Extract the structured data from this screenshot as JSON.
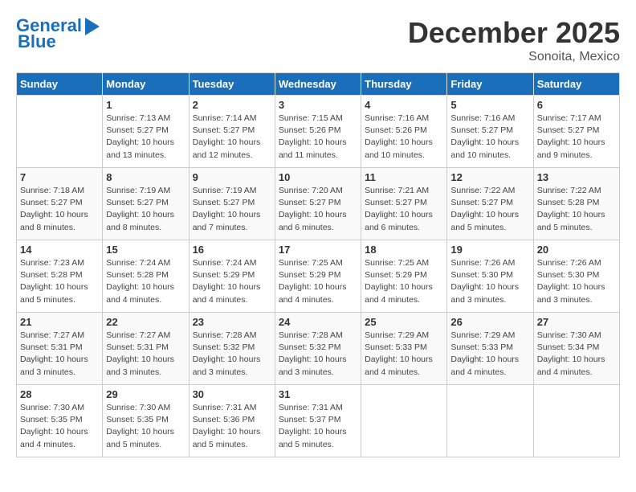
{
  "header": {
    "logo_line1": "General",
    "logo_line2": "Blue",
    "month": "December 2025",
    "location": "Sonoita, Mexico"
  },
  "days_of_week": [
    "Sunday",
    "Monday",
    "Tuesday",
    "Wednesday",
    "Thursday",
    "Friday",
    "Saturday"
  ],
  "weeks": [
    [
      {
        "day": "",
        "info": ""
      },
      {
        "day": "1",
        "info": "Sunrise: 7:13 AM\nSunset: 5:27 PM\nDaylight: 10 hours\nand 13 minutes."
      },
      {
        "day": "2",
        "info": "Sunrise: 7:14 AM\nSunset: 5:27 PM\nDaylight: 10 hours\nand 12 minutes."
      },
      {
        "day": "3",
        "info": "Sunrise: 7:15 AM\nSunset: 5:26 PM\nDaylight: 10 hours\nand 11 minutes."
      },
      {
        "day": "4",
        "info": "Sunrise: 7:16 AM\nSunset: 5:26 PM\nDaylight: 10 hours\nand 10 minutes."
      },
      {
        "day": "5",
        "info": "Sunrise: 7:16 AM\nSunset: 5:27 PM\nDaylight: 10 hours\nand 10 minutes."
      },
      {
        "day": "6",
        "info": "Sunrise: 7:17 AM\nSunset: 5:27 PM\nDaylight: 10 hours\nand 9 minutes."
      }
    ],
    [
      {
        "day": "7",
        "info": "Sunrise: 7:18 AM\nSunset: 5:27 PM\nDaylight: 10 hours\nand 8 minutes."
      },
      {
        "day": "8",
        "info": "Sunrise: 7:19 AM\nSunset: 5:27 PM\nDaylight: 10 hours\nand 8 minutes."
      },
      {
        "day": "9",
        "info": "Sunrise: 7:19 AM\nSunset: 5:27 PM\nDaylight: 10 hours\nand 7 minutes."
      },
      {
        "day": "10",
        "info": "Sunrise: 7:20 AM\nSunset: 5:27 PM\nDaylight: 10 hours\nand 6 minutes."
      },
      {
        "day": "11",
        "info": "Sunrise: 7:21 AM\nSunset: 5:27 PM\nDaylight: 10 hours\nand 6 minutes."
      },
      {
        "day": "12",
        "info": "Sunrise: 7:22 AM\nSunset: 5:27 PM\nDaylight: 10 hours\nand 5 minutes."
      },
      {
        "day": "13",
        "info": "Sunrise: 7:22 AM\nSunset: 5:28 PM\nDaylight: 10 hours\nand 5 minutes."
      }
    ],
    [
      {
        "day": "14",
        "info": "Sunrise: 7:23 AM\nSunset: 5:28 PM\nDaylight: 10 hours\nand 5 minutes."
      },
      {
        "day": "15",
        "info": "Sunrise: 7:24 AM\nSunset: 5:28 PM\nDaylight: 10 hours\nand 4 minutes."
      },
      {
        "day": "16",
        "info": "Sunrise: 7:24 AM\nSunset: 5:29 PM\nDaylight: 10 hours\nand 4 minutes."
      },
      {
        "day": "17",
        "info": "Sunrise: 7:25 AM\nSunset: 5:29 PM\nDaylight: 10 hours\nand 4 minutes."
      },
      {
        "day": "18",
        "info": "Sunrise: 7:25 AM\nSunset: 5:29 PM\nDaylight: 10 hours\nand 4 minutes."
      },
      {
        "day": "19",
        "info": "Sunrise: 7:26 AM\nSunset: 5:30 PM\nDaylight: 10 hours\nand 3 minutes."
      },
      {
        "day": "20",
        "info": "Sunrise: 7:26 AM\nSunset: 5:30 PM\nDaylight: 10 hours\nand 3 minutes."
      }
    ],
    [
      {
        "day": "21",
        "info": "Sunrise: 7:27 AM\nSunset: 5:31 PM\nDaylight: 10 hours\nand 3 minutes."
      },
      {
        "day": "22",
        "info": "Sunrise: 7:27 AM\nSunset: 5:31 PM\nDaylight: 10 hours\nand 3 minutes."
      },
      {
        "day": "23",
        "info": "Sunrise: 7:28 AM\nSunset: 5:32 PM\nDaylight: 10 hours\nand 3 minutes."
      },
      {
        "day": "24",
        "info": "Sunrise: 7:28 AM\nSunset: 5:32 PM\nDaylight: 10 hours\nand 3 minutes."
      },
      {
        "day": "25",
        "info": "Sunrise: 7:29 AM\nSunset: 5:33 PM\nDaylight: 10 hours\nand 4 minutes."
      },
      {
        "day": "26",
        "info": "Sunrise: 7:29 AM\nSunset: 5:33 PM\nDaylight: 10 hours\nand 4 minutes."
      },
      {
        "day": "27",
        "info": "Sunrise: 7:30 AM\nSunset: 5:34 PM\nDaylight: 10 hours\nand 4 minutes."
      }
    ],
    [
      {
        "day": "28",
        "info": "Sunrise: 7:30 AM\nSunset: 5:35 PM\nDaylight: 10 hours\nand 4 minutes."
      },
      {
        "day": "29",
        "info": "Sunrise: 7:30 AM\nSunset: 5:35 PM\nDaylight: 10 hours\nand 5 minutes."
      },
      {
        "day": "30",
        "info": "Sunrise: 7:31 AM\nSunset: 5:36 PM\nDaylight: 10 hours\nand 5 minutes."
      },
      {
        "day": "31",
        "info": "Sunrise: 7:31 AM\nSunset: 5:37 PM\nDaylight: 10 hours\nand 5 minutes."
      },
      {
        "day": "",
        "info": ""
      },
      {
        "day": "",
        "info": ""
      },
      {
        "day": "",
        "info": ""
      }
    ]
  ]
}
